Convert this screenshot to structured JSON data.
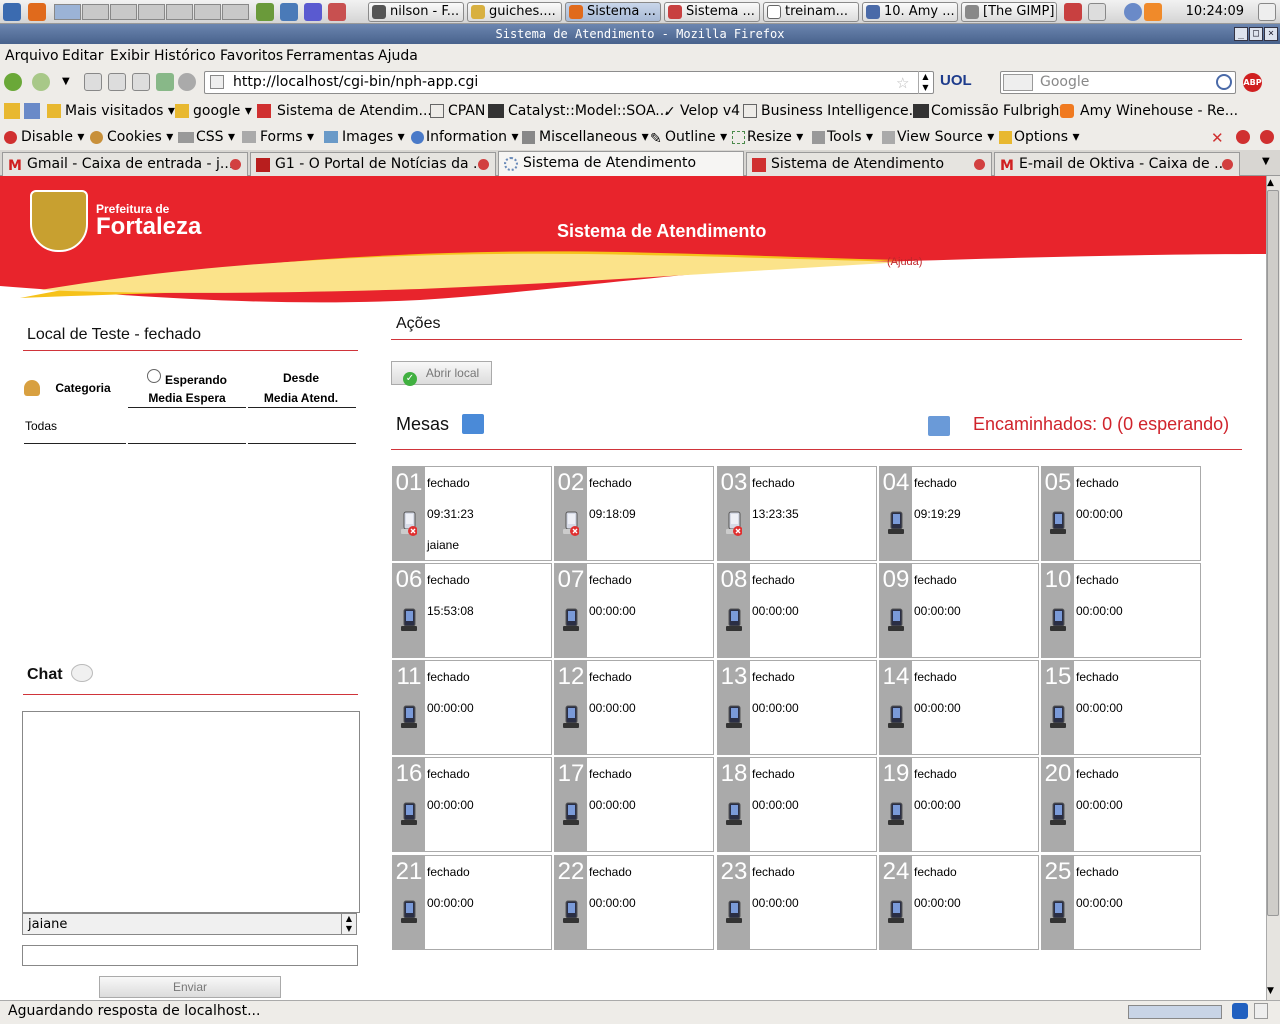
{
  "taskbar": {
    "tasks": [
      {
        "label": "nilson - F...",
        "icon": "terminal-icon"
      },
      {
        "label": "guiches....",
        "icon": "editor-icon"
      },
      {
        "label": "Sistema ...",
        "icon": "firefox-icon"
      },
      {
        "label": "Sistema ...",
        "icon": "app-icon"
      },
      {
        "label": "treinam...",
        "icon": "document-icon"
      },
      {
        "label": "10. Amy ...",
        "icon": "player-icon"
      },
      {
        "label": "[The GIMP]",
        "icon": "gimp-icon"
      }
    ],
    "clock": "10:24:09"
  },
  "window": {
    "title": "Sistema de Atendimento - Mozilla Firefox"
  },
  "menu": [
    "Arquivo",
    "Editar",
    "Exibir",
    "Histórico",
    "Favoritos",
    "Ferramentas",
    "Ajuda"
  ],
  "nav": {
    "url": "http://localhost/cgi-bin/nph-app.cgi",
    "search_placeholder": "Google"
  },
  "bookmarks": [
    "Mais visitados",
    "google",
    "Sistema de Atendim...",
    "CPAN",
    "Catalyst::Model::SOA...",
    "Velop v4",
    "Business Intelligence...",
    "Comissão Fulbright",
    "Amy Winehouse - Re..."
  ],
  "devbar": [
    "Disable",
    "Cookies",
    "CSS",
    "Forms",
    "Images",
    "Information",
    "Miscellaneous",
    "Outline",
    "Resize",
    "Tools",
    "View Source",
    "Options"
  ],
  "tabs": [
    {
      "label": "Gmail - Caixa de entrada - j...",
      "active": false
    },
    {
      "label": "G1 - O Portal de Notícias da ...",
      "active": false
    },
    {
      "label": "Sistema de Atendimento",
      "active": true
    },
    {
      "label": "Sistema de Atendimento",
      "active": false
    },
    {
      "label": "E-mail de Oktiva - Caixa de ...",
      "active": false
    }
  ],
  "status": "Aguardando resposta de localhost...",
  "page": {
    "logo_line1": "Prefeitura de",
    "logo_line2": "Fortaleza",
    "title": "Sistema de Atendimento",
    "help_link": "(Ajuda)",
    "local": {
      "title": "Local de Teste - fechado",
      "col_categoria": "Categoria",
      "col_esperando": "Esperando",
      "col_media_espera": "Media Espera",
      "col_desde": "Desde",
      "col_media_atend": "Media Atend.",
      "row_todas": "Todas"
    },
    "chat": {
      "title": "Chat",
      "user_select": "jaiane",
      "message_value": "",
      "send_label": "Enviar"
    },
    "acoes": {
      "title": "Ações",
      "abrir_label": "Abrir local"
    },
    "mesas": {
      "title": "Mesas",
      "encaminhados": "Encaminhados: 0 (0 esperando)",
      "desks": [
        {
          "num": "01",
          "status": "fechado",
          "time": "09:31:23",
          "user": "jaiane",
          "offline": true
        },
        {
          "num": "02",
          "status": "fechado",
          "time": "09:18:09",
          "user": "",
          "offline": true
        },
        {
          "num": "03",
          "status": "fechado",
          "time": "13:23:35",
          "user": "",
          "offline": true
        },
        {
          "num": "04",
          "status": "fechado",
          "time": "09:19:29",
          "user": "",
          "offline": false
        },
        {
          "num": "05",
          "status": "fechado",
          "time": "00:00:00",
          "user": "",
          "offline": false
        },
        {
          "num": "06",
          "status": "fechado",
          "time": "15:53:08",
          "user": "",
          "offline": false
        },
        {
          "num": "07",
          "status": "fechado",
          "time": "00:00:00",
          "user": "",
          "offline": false
        },
        {
          "num": "08",
          "status": "fechado",
          "time": "00:00:00",
          "user": "",
          "offline": false
        },
        {
          "num": "09",
          "status": "fechado",
          "time": "00:00:00",
          "user": "",
          "offline": false
        },
        {
          "num": "10",
          "status": "fechado",
          "time": "00:00:00",
          "user": "",
          "offline": false
        },
        {
          "num": "11",
          "status": "fechado",
          "time": "00:00:00",
          "user": "",
          "offline": false
        },
        {
          "num": "12",
          "status": "fechado",
          "time": "00:00:00",
          "user": "",
          "offline": false
        },
        {
          "num": "13",
          "status": "fechado",
          "time": "00:00:00",
          "user": "",
          "offline": false
        },
        {
          "num": "14",
          "status": "fechado",
          "time": "00:00:00",
          "user": "",
          "offline": false
        },
        {
          "num": "15",
          "status": "fechado",
          "time": "00:00:00",
          "user": "",
          "offline": false
        },
        {
          "num": "16",
          "status": "fechado",
          "time": "00:00:00",
          "user": "",
          "offline": false
        },
        {
          "num": "17",
          "status": "fechado",
          "time": "00:00:00",
          "user": "",
          "offline": false
        },
        {
          "num": "18",
          "status": "fechado",
          "time": "00:00:00",
          "user": "",
          "offline": false
        },
        {
          "num": "19",
          "status": "fechado",
          "time": "00:00:00",
          "user": "",
          "offline": false
        },
        {
          "num": "20",
          "status": "fechado",
          "time": "00:00:00",
          "user": "",
          "offline": false
        },
        {
          "num": "21",
          "status": "fechado",
          "time": "00:00:00",
          "user": "",
          "offline": false
        },
        {
          "num": "22",
          "status": "fechado",
          "time": "00:00:00",
          "user": "",
          "offline": false
        },
        {
          "num": "23",
          "status": "fechado",
          "time": "00:00:00",
          "user": "",
          "offline": false
        },
        {
          "num": "24",
          "status": "fechado",
          "time": "00:00:00",
          "user": "",
          "offline": false
        },
        {
          "num": "25",
          "status": "fechado",
          "time": "00:00:00",
          "user": "",
          "offline": false
        }
      ]
    }
  },
  "colors": {
    "brand_red": "#e8242c",
    "accent_yellow": "#f6c21a",
    "desk_gray": "#aaaaaa"
  }
}
